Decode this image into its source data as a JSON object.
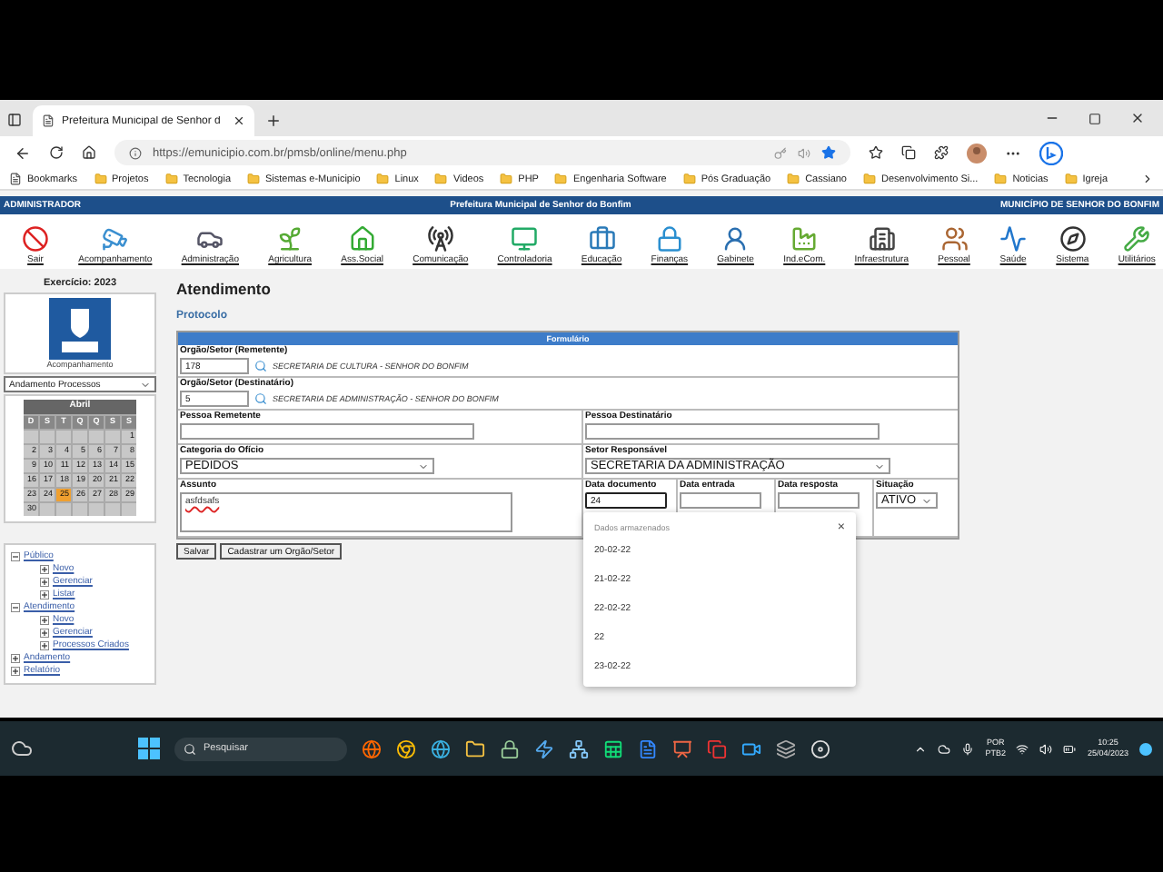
{
  "browser": {
    "tabs": [
      {
        "title": "Prefeitura Municipal de Senhor d",
        "selected": true
      }
    ],
    "address": "https://emunicipio.com.br/pmsb/online/menu.php",
    "bookmarks": [
      {
        "label": "Bookmarks",
        "kind": "page"
      },
      {
        "label": "Projetos",
        "kind": "folder"
      },
      {
        "label": "Tecnologia",
        "kind": "folder"
      },
      {
        "label": "Sistemas e-Municipio",
        "kind": "folder"
      },
      {
        "label": "Linux",
        "kind": "folder"
      },
      {
        "label": "Videos",
        "kind": "folder"
      },
      {
        "label": "PHP",
        "kind": "folder"
      },
      {
        "label": "Engenharia Software",
        "kind": "folder"
      },
      {
        "label": "Pós Graduação",
        "kind": "folder"
      },
      {
        "label": "Cassiano",
        "kind": "folder"
      },
      {
        "label": "Desenvolvimento Si...",
        "kind": "folder"
      },
      {
        "label": "Noticias",
        "kind": "folder"
      },
      {
        "label": "Igreja",
        "kind": "folder"
      }
    ]
  },
  "header": {
    "user": "ADMINISTRADOR",
    "title": "Prefeitura Municipal de Senhor do Bonfim",
    "municipality": "MUNICÍPIO DE SENHOR DO BONFIM"
  },
  "modules": [
    {
      "label": "Sair"
    },
    {
      "label": "Acompanhamento"
    },
    {
      "label": "Administração"
    },
    {
      "label": "Agricultura"
    },
    {
      "label": "Ass.Social"
    },
    {
      "label": "Comunicação"
    },
    {
      "label": "Controladoria"
    },
    {
      "label": "Educação"
    },
    {
      "label": "Finanças"
    },
    {
      "label": "Gabinete"
    },
    {
      "label": "Ind.eCom."
    },
    {
      "label": "Infraestrutura"
    },
    {
      "label": "Pessoal"
    },
    {
      "label": "Saúde"
    },
    {
      "label": "Sistema"
    },
    {
      "label": "Utilitários"
    }
  ],
  "sidebar": {
    "exercise": "Exercício: 2023",
    "logo_caption": "Acompanhamento",
    "select": "Andamento Processos",
    "calendar": {
      "month": "Abril",
      "weekdays": [
        "D",
        "S",
        "T",
        "Q",
        "Q",
        "S",
        "S"
      ],
      "weeks": [
        [
          {
            "day": "1",
            "selected": false
          }
        ],
        [
          {
            "day": "2",
            "selected": false
          },
          {
            "day": "3",
            "selected": false
          },
          {
            "day": "4",
            "selected": false
          },
          {
            "day": "5",
            "selected": false
          },
          {
            "day": "6",
            "selected": false
          },
          {
            "day": "7",
            "selected": false
          },
          {
            "day": "8",
            "selected": false
          }
        ],
        [
          {
            "day": "9",
            "selected": false
          },
          {
            "day": "10",
            "selected": false
          },
          {
            "day": "11",
            "selected": false
          },
          {
            "day": "12",
            "selected": false
          },
          {
            "day": "13",
            "selected": false
          },
          {
            "day": "14",
            "selected": false
          },
          {
            "day": "15",
            "selected": false
          }
        ],
        [
          {
            "day": "16",
            "selected": false
          },
          {
            "day": "17",
            "selected": false
          },
          {
            "day": "18",
            "selected": false
          },
          {
            "day": "19",
            "selected": false
          },
          {
            "day": "20",
            "selected": false
          },
          {
            "day": "21",
            "selected": false
          },
          {
            "day": "22",
            "selected": false
          }
        ],
        [
          {
            "day": "23",
            "selected": false
          },
          {
            "day": "24",
            "selected": false
          },
          {
            "day": "25",
            "selected": true
          },
          {
            "day": "26",
            "selected": false
          },
          {
            "day": "27",
            "selected": false
          },
          {
            "day": "28",
            "selected": false
          },
          {
            "day": "29",
            "selected": false
          }
        ],
        [
          {
            "day": "30",
            "selected": false
          }
        ]
      ]
    },
    "tree": [
      {
        "label": "Público",
        "expanded": true,
        "children": [
          {
            "label": "Novo"
          },
          {
            "label": "Gerenciar"
          },
          {
            "label": "Listar"
          }
        ]
      },
      {
        "label": "Atendimento",
        "expanded": true,
        "children": [
          {
            "label": "Novo"
          },
          {
            "label": "Gerenciar"
          },
          {
            "label": "Processos Criados"
          }
        ]
      },
      {
        "label": "Andamento",
        "expanded": false
      },
      {
        "label": "Relatório",
        "expanded": false
      }
    ]
  },
  "main": {
    "title": "Atendimento",
    "subtitle": "Protocolo",
    "form": {
      "header": "Formulário",
      "sender_org": {
        "label": "Orgão/Setor (Remetente)",
        "value": "178",
        "name": "SECRETARIA DE CULTURA - SENHOR DO BONFIM"
      },
      "recipient_org": {
        "label": "Orgão/Setor (Destinatário)",
        "value": "5",
        "name": "SECRETARIA DE ADMINISTRAÇÃO - SENHOR DO BONFIM"
      },
      "sender_person": {
        "label": "Pessoa Remetente"
      },
      "recipient_person": {
        "label": "Pessoa Destinatário"
      },
      "category": {
        "label": "Categoria do Ofício",
        "value": "PEDIDOS"
      },
      "responsible": {
        "label": "Setor Responsável",
        "value": "SECRETARIA DA ADMINISTRAÇÃO"
      },
      "subject": {
        "label": "Assunto",
        "value": "asfdsafs"
      },
      "date_document": {
        "label": "Data documento",
        "value": "24"
      },
      "date_entry": {
        "label": "Data entrada"
      },
      "date_reply": {
        "label": "Data resposta"
      },
      "status": {
        "label": "Situação",
        "value": "ATIVO"
      }
    },
    "buttons": [
      "Salvar",
      "Cadastrar um Orgão/Setor"
    ],
    "autocomplete": {
      "title": "Dados armazenados",
      "close": "×",
      "items": [
        "20-02-22",
        "21-02-22",
        "22-02-22",
        "22",
        "23-02-22"
      ]
    }
  },
  "taskbar": {
    "search": "Pesquisar",
    "language": "POR",
    "layout": "PTB2",
    "time": "10:25",
    "date": "25/04/2023"
  }
}
